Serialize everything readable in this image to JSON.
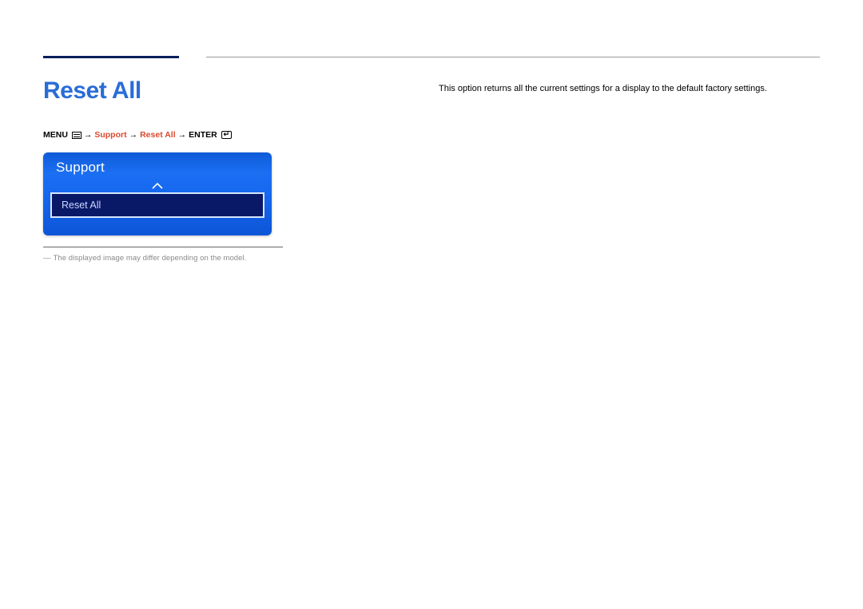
{
  "page": {
    "title": "Reset All"
  },
  "breadcrumb": {
    "menu_label": "MENU",
    "step1": "Support",
    "step2": "Reset All",
    "enter_label": "ENTER"
  },
  "osd": {
    "title": "Support",
    "selected_item": "Reset All"
  },
  "note": {
    "text": "The displayed image may differ depending on the model."
  },
  "description": {
    "text": "This option returns all the current settings for a display to the default factory settings."
  }
}
